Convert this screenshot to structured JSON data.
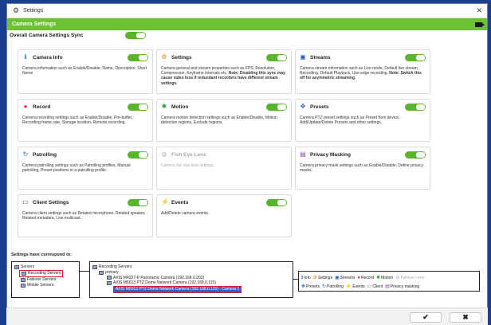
{
  "window": {
    "title": "Settings",
    "close_glyph": "✕"
  },
  "header": {
    "title": "Camera Settings",
    "icon": "video-camera-icon"
  },
  "sync": {
    "label": "Overall Camera Settings Sync",
    "enabled": true
  },
  "cards": [
    {
      "key": "camera-info",
      "title": "Camera Info",
      "icon": "info-icon",
      "enabled": true,
      "desc": "Camera information such as Enable/Disable, Name, Description, Short Name",
      "note": ""
    },
    {
      "key": "settings",
      "title": "Settings",
      "icon": "gear-icon",
      "enabled": true,
      "desc": "Camera general and stream properties such as FPS, Resolution, Compression, Keyframe Intervals etc.",
      "note": "Note: Disabling this sync may cause video loss if redundant recorders have different stream settings."
    },
    {
      "key": "streams",
      "title": "Streams",
      "icon": "streams-icon",
      "enabled": true,
      "desc": "Camera stream information such as Live mode, Default live stream, Recording, Default Playback, Use edge recording.",
      "note": "Note: Switch this off for asymmetric streaming."
    },
    {
      "key": "record",
      "title": "Record",
      "icon": "record-icon",
      "enabled": true,
      "desc": "Camera recording settings such as Enable/Disable, Pre-buffer, Recording frame rate, Storage location, Remote recording.",
      "note": ""
    },
    {
      "key": "motion",
      "title": "Motion",
      "icon": "motion-icon",
      "enabled": true,
      "desc": "Camera motion detection settings such as Enable/Disable, Motion detection regions, Exclude regions.",
      "note": ""
    },
    {
      "key": "presets",
      "title": "Presets",
      "icon": "presets-icon",
      "enabled": true,
      "desc": "Camera PTZ preset settings such as Preset from device, Add/Update/Delete Presets and other settings.",
      "note": ""
    },
    {
      "key": "patrolling",
      "title": "Patrolling",
      "icon": "patrolling-icon",
      "enabled": true,
      "desc": "Camera patrolling settings such as Patrolling profiles, Manual patrolling, Preset positions in a patrolling profile.",
      "note": ""
    },
    {
      "key": "fish-eye",
      "title": "Fish Eye Lens",
      "icon": "fish-eye-icon",
      "enabled": false,
      "disabled": true,
      "desc": "Camera fish eye lens settings.",
      "note": ""
    },
    {
      "key": "privacy",
      "title": "Privacy Masking",
      "icon": "privacy-mask-icon",
      "enabled": true,
      "desc": "Camera privacy mask settings such as Enable/Disable, Define privacy masks.",
      "note": ""
    },
    {
      "key": "client",
      "title": "Client Settings",
      "icon": "client-icon",
      "enabled": true,
      "desc": "Camera client settings such as Related microphone, Related speaker, Related metadata, Live multicast.",
      "note": ""
    },
    {
      "key": "events",
      "title": "Events",
      "icon": "events-icon",
      "enabled": true,
      "desc": "Add/Delete camera events.",
      "note": ""
    }
  ],
  "correspond": {
    "label": "Settings have correspond to:",
    "tree1": [
      "Servers",
      "Recording Servers",
      "Failover Servers",
      "Mobile Servers"
    ],
    "tree2": [
      "Recording Servers",
      "primary",
      "AXIS M4327-P Panoramic Camera (192.168.0.202)",
      "AXIS M5013 PTZ Dome Network Camera (192.168.0.115)",
      "AXIS M5013 PTZ Dome Network Camera (192.168.0.115) - Camera 1"
    ]
  },
  "legend": {
    "row1": [
      "Info",
      "Settings",
      "Streams",
      "Record",
      "Motion",
      "Fisheye Lens"
    ],
    "row2": [
      "Presets",
      "Patrolling",
      "Events",
      "Client",
      "Privacy masking"
    ]
  },
  "footer": {
    "ok_glyph": "✔",
    "cancel_glyph": "✖"
  }
}
